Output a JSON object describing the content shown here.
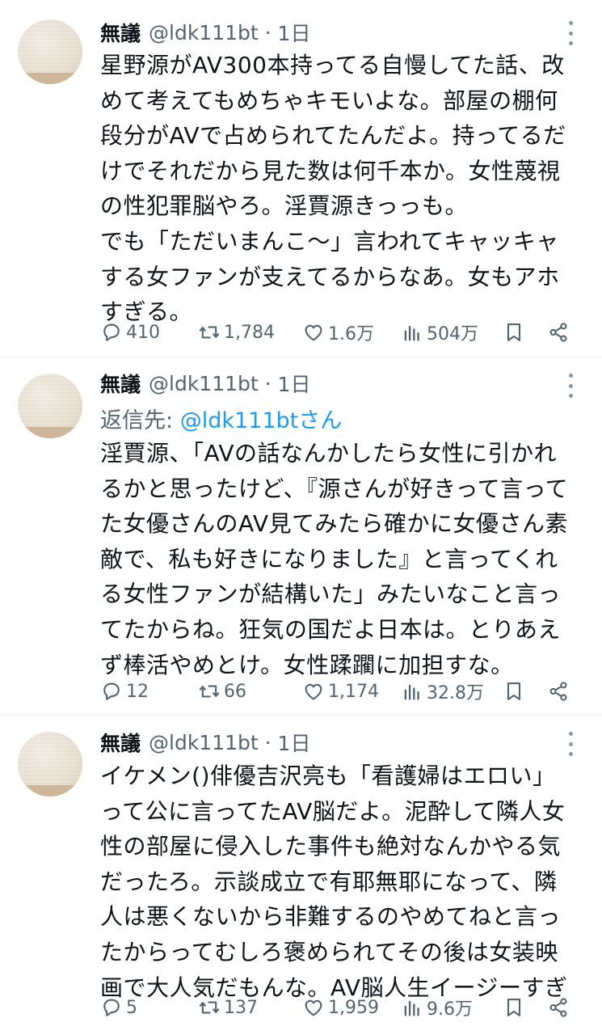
{
  "tweets": [
    {
      "name": "無議",
      "handle": "@ldk111bt",
      "time": "1日",
      "reply_label": "",
      "reply_handle": "",
      "lines": [
        "星野源がAV300本持ってる自慢してた話、改",
        "めて考えてもめちゃキモいよな。部屋の棚何",
        "段分がAVで占められてたんだよ。持ってるだ",
        "けでそれだから見た数は何千本か。女性蔑視",
        "の性犯罪脳やろ。淫賈源きっっも。",
        "でも「ただいまんこ〜」言われてキャッキャ",
        "する女ファンが支えてるからなあ。女もアホ",
        "すぎる。"
      ],
      "replies": "410",
      "retweets": "1,784",
      "likes": "1.6万",
      "views": "504万"
    },
    {
      "name": "無議",
      "handle": "@ldk111bt",
      "time": "1日",
      "reply_label": "返信先: ",
      "reply_handle": "@ldk111btさん",
      "lines": [
        "淫賈源、「AVの話なんかしたら女性に引かれ",
        "るかと思ったけど、『源さんが好きって言って",
        "た女優さんのAV見てみたら確かに女優さん素",
        "敵で、私も好きになりました』と言ってくれ",
        "る女性ファンが結構いた」みたいなこと言っ",
        "てたからね。狂気の国だよ日本は。とりあえ",
        "ず棒活やめとけ。女性蹂躙に加担すな。"
      ],
      "replies": "12",
      "retweets": "66",
      "likes": "1,174",
      "views": "32.8万"
    },
    {
      "name": "無議",
      "handle": "@ldk111bt",
      "time": "1日",
      "reply_label": "",
      "reply_handle": "",
      "lines": [
        "イケメン()俳優吉沢亮も「看護婦はエロい」",
        "って公に言ってたAV脳だよ。泥酔して隣人女",
        "性の部屋に侵入した事件も絶対なんかやる気",
        "だったろ。示談成立で有耶無耶になって、隣",
        "人は悪くないから非難するのやめてねと言っ",
        "たからってむしろ褒められてその後は女装映",
        "画で大人気だもんな。AV脳人生イージーすぎ"
      ],
      "replies": "5",
      "retweets": "137",
      "likes": "1,959",
      "views": "9.6万"
    }
  ],
  "colors": {
    "text": "#0f1419",
    "secondary": "#536471",
    "link": "#1d9bf0",
    "divider": "#eff3f4"
  },
  "icons": {
    "reply": "reply-bubble-icon",
    "retweet": "retweet-arrows-icon",
    "like": "heart-outline-icon",
    "views": "bar-chart-views-icon",
    "bookmark": "bookmark-icon",
    "share": "share-icon",
    "more": "more-vertical-icon"
  }
}
